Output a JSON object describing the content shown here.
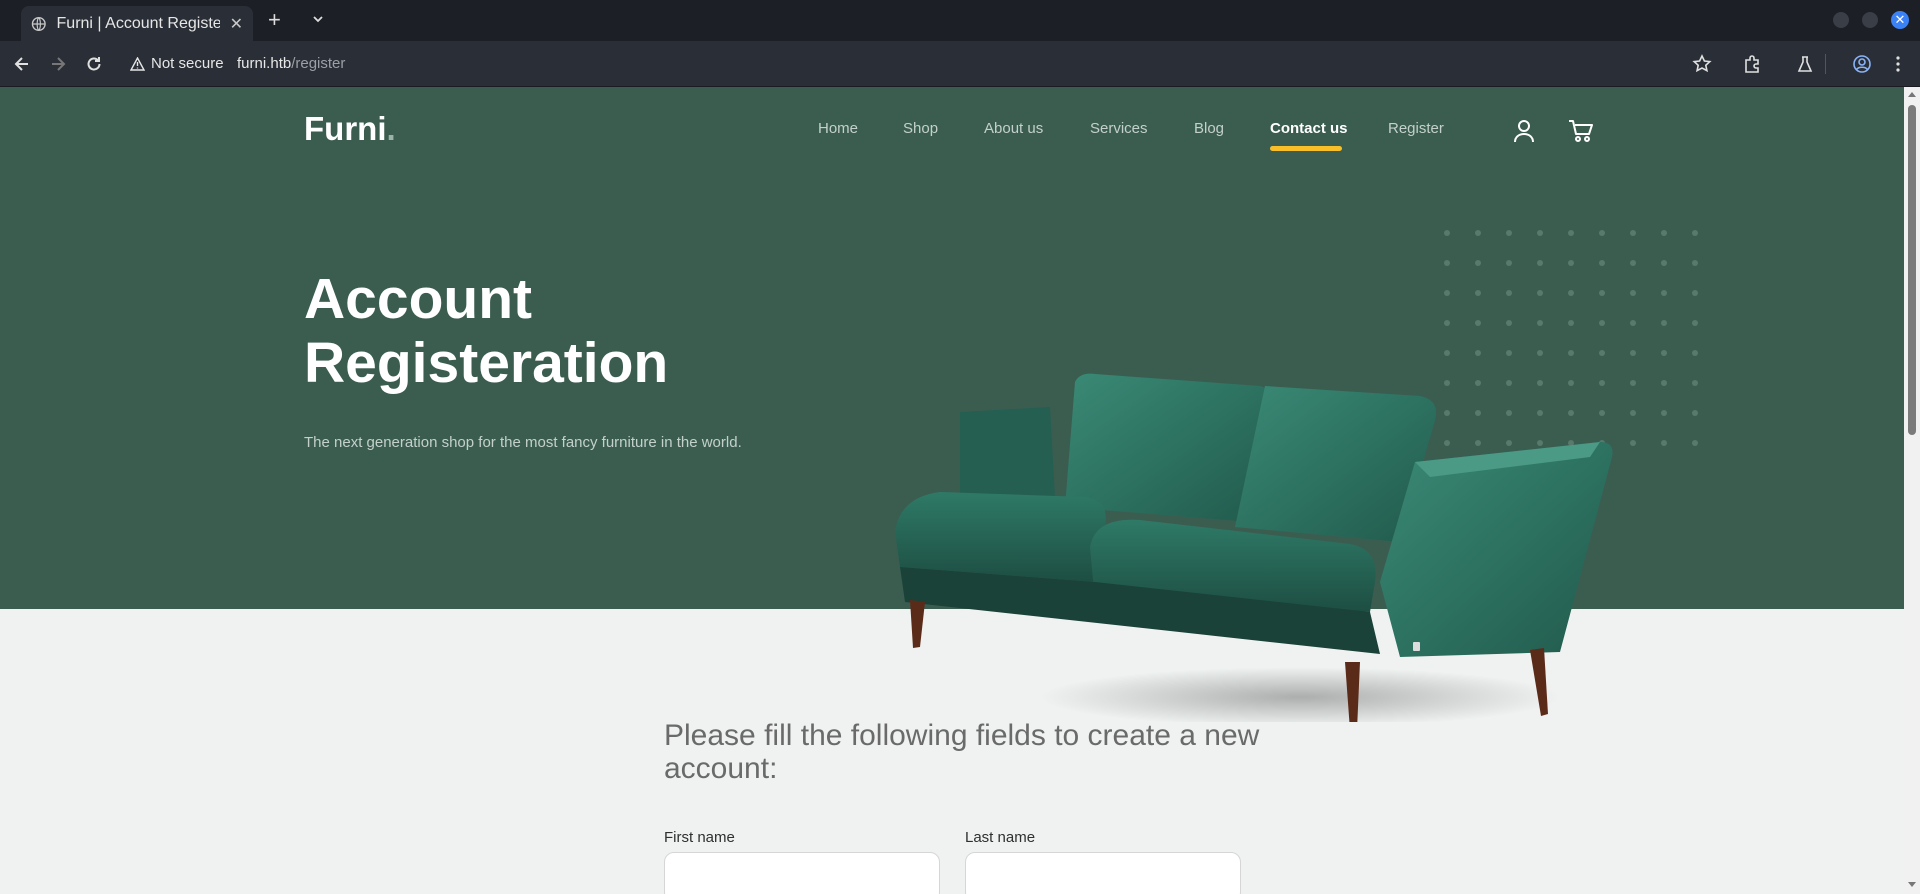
{
  "browser": {
    "tab_title": "Furni | Account Registeration",
    "new_tab": "+",
    "close_tab": "✕",
    "security_label": "Not secure",
    "url_host": "furni.htb",
    "url_path": "/register"
  },
  "site": {
    "logo": "Furni",
    "logo_dot": ".",
    "nav": [
      "Home",
      "Shop",
      "About us",
      "Services",
      "Blog",
      "Contact us",
      "Register"
    ],
    "active_nav": "Contact us"
  },
  "hero": {
    "title": "Account Registeration",
    "subtitle": "The next generation shop for the most fancy furniture in the world."
  },
  "form": {
    "heading": "Please fill the following fields to create a new account:",
    "first_name_label": "First name",
    "last_name_label": "Last name",
    "first_name_value": "",
    "last_name_value": ""
  },
  "colors": {
    "hero_bg": "#3b5d50",
    "accent": "#f9bf29",
    "page_bg": "#eff2f1"
  }
}
